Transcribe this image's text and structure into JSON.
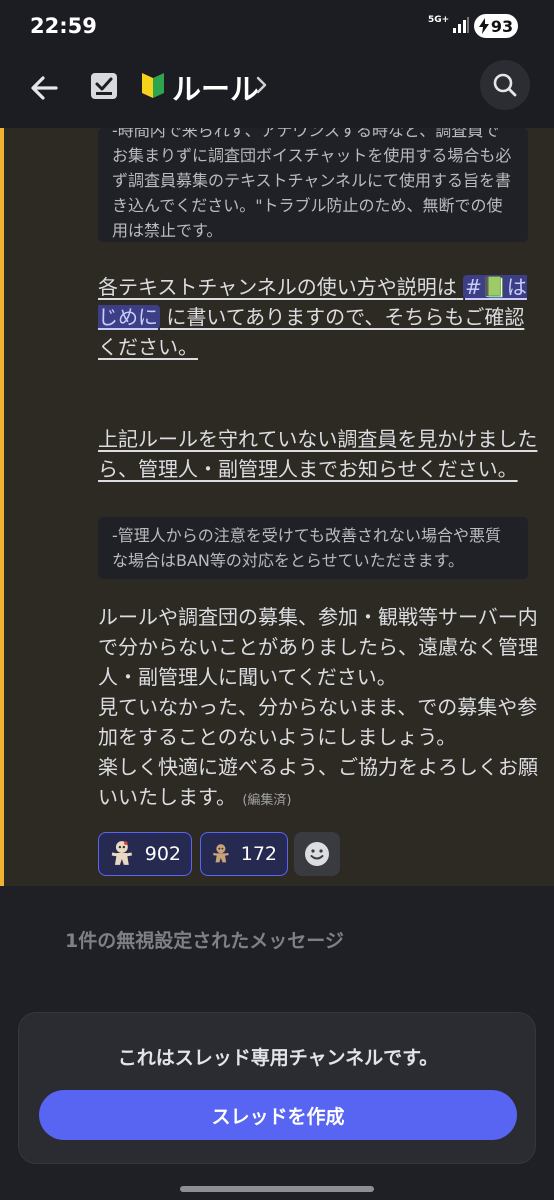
{
  "status_bar": {
    "time": "22:59",
    "network": "5G+",
    "battery": "93"
  },
  "header": {
    "channel_emoji": "beginner-badge-icon",
    "channel_name": "ルール"
  },
  "messages": {
    "quote_top": "-時間内で来られず、アナウンスする時など、調査員でお集まりずに調査団ボイスチャットを使用する場合も必ず調査員募集のテキストチャンネルにて使用する旨を書き込んでください。\"トラブル防止のため、無断での使用は禁止です。",
    "msg1_before": "各テキストチャンネルの使い方や説明は",
    "msg1_mention": "#📗はじめに",
    "msg1_after": "に書いてありますので、そちらもご確認ください。",
    "msg2": "上記ルールを守れていない調査員を見かけましたら、管理人・副管理人までお知らせください。",
    "quote_mid": "-管理人からの注意を受けても改善されない場合や悪質な場合はBAN等の対応をとらせていただきます。",
    "msg3": "ルールや調査団の募集、参加・観戦等サーバー内で分からないことがありましたら、遠慮なく管理人・副管理人に聞いてください。\n見ていなかった、分からないまま、での募集や参加をすることのないようにしましょう。\n楽しく快適に遊べるよう、ご協力をよろしくお願いいたします。",
    "edited": "(編集済)"
  },
  "reactions": [
    {
      "icon": "voodoo-doll-icon",
      "count": "902"
    },
    {
      "icon": "voodoo-doll-icon",
      "count": "172"
    }
  ],
  "ignored_message": "1件の無視設定されたメッセージ",
  "bottom_panel": {
    "notice": "これはスレッド専用チャンネルです。",
    "button_label": "スレッドを作成"
  },
  "colors": {
    "accent": "#f0b232",
    "brand": "#5865f2"
  }
}
